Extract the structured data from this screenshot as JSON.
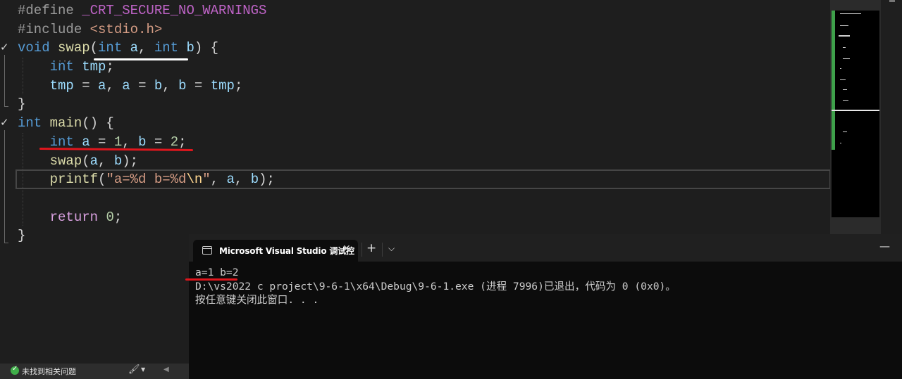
{
  "editor": {
    "lines": [
      [
        {
          "t": "#define ",
          "c": "pp"
        },
        {
          "t": "_CRT_SECURE_NO_WARNINGS",
          "c": "mac"
        }
      ],
      [
        {
          "t": "#include ",
          "c": "pp"
        },
        {
          "t": "<stdio.h>",
          "c": "inc"
        }
      ],
      [
        {
          "t": "void ",
          "c": "kw"
        },
        {
          "t": "swap",
          "c": "fn"
        },
        {
          "t": "(",
          "c": ""
        },
        {
          "t": "int ",
          "c": "kw"
        },
        {
          "t": "a",
          "c": "var"
        },
        {
          "t": ", ",
          "c": ""
        },
        {
          "t": "int ",
          "c": "kw"
        },
        {
          "t": "b",
          "c": "var"
        },
        {
          "t": ") {",
          "c": ""
        }
      ],
      [
        {
          "t": "    ",
          "c": ""
        },
        {
          "t": "int ",
          "c": "kw"
        },
        {
          "t": "tmp",
          "c": "var"
        },
        {
          "t": ";",
          "c": ""
        }
      ],
      [
        {
          "t": "    ",
          "c": ""
        },
        {
          "t": "tmp",
          "c": "var"
        },
        {
          "t": " = ",
          "c": ""
        },
        {
          "t": "a",
          "c": "var"
        },
        {
          "t": ", ",
          "c": ""
        },
        {
          "t": "a",
          "c": "var"
        },
        {
          "t": " = ",
          "c": ""
        },
        {
          "t": "b",
          "c": "var"
        },
        {
          "t": ", ",
          "c": ""
        },
        {
          "t": "b",
          "c": "var"
        },
        {
          "t": " = ",
          "c": ""
        },
        {
          "t": "tmp",
          "c": "var"
        },
        {
          "t": ";",
          "c": ""
        }
      ],
      [
        {
          "t": "}",
          "c": ""
        }
      ],
      [
        {
          "t": "int ",
          "c": "kw"
        },
        {
          "t": "main",
          "c": "fn"
        },
        {
          "t": "() {",
          "c": ""
        }
      ],
      [
        {
          "t": "    ",
          "c": ""
        },
        {
          "t": "int ",
          "c": "kw"
        },
        {
          "t": "a",
          "c": "var"
        },
        {
          "t": " = ",
          "c": ""
        },
        {
          "t": "1",
          "c": "num"
        },
        {
          "t": ", ",
          "c": ""
        },
        {
          "t": "b",
          "c": "var"
        },
        {
          "t": " = ",
          "c": ""
        },
        {
          "t": "2",
          "c": "num"
        },
        {
          "t": ";",
          "c": ""
        }
      ],
      [
        {
          "t": "    ",
          "c": ""
        },
        {
          "t": "swap",
          "c": "fn"
        },
        {
          "t": "(",
          "c": ""
        },
        {
          "t": "a",
          "c": "var"
        },
        {
          "t": ", ",
          "c": ""
        },
        {
          "t": "b",
          "c": "var"
        },
        {
          "t": ");",
          "c": ""
        }
      ],
      [
        {
          "t": "    ",
          "c": ""
        },
        {
          "t": "printf",
          "c": "fn"
        },
        {
          "t": "(",
          "c": ""
        },
        {
          "t": "\"a=%d b=%d",
          "c": "str"
        },
        {
          "t": "\\n",
          "c": "esc"
        },
        {
          "t": "\"",
          "c": "str"
        },
        {
          "t": ", ",
          "c": ""
        },
        {
          "t": "a",
          "c": "var"
        },
        {
          "t": ", ",
          "c": ""
        },
        {
          "t": "b",
          "c": "var"
        },
        {
          "t": ");",
          "c": ""
        }
      ],
      [
        {
          "t": "",
          "c": ""
        }
      ],
      [
        {
          "t": "    ",
          "c": ""
        },
        {
          "t": "return ",
          "c": "ctl"
        },
        {
          "t": "0",
          "c": "num"
        },
        {
          "t": ";",
          "c": ""
        }
      ],
      [
        {
          "t": "}",
          "c": ""
        }
      ]
    ],
    "checkmark": "✓"
  },
  "status_bar": {
    "issues_text": "未找到相关问题"
  },
  "terminal": {
    "tab_title": "Microsoft Visual Studio 调试控",
    "close_glyph": "✕",
    "new_tab_glyph": "+",
    "dropdown_glyph": "⌵",
    "minimize_glyph": "—",
    "output_line1": "a=1 b=2",
    "output_line2": "",
    "output_line3": "D:\\vs2022 c project\\9-6-1\\x64\\Debug\\9-6-1.exe (进程 7996)已退出，代码为 0 (0x0)。",
    "output_line4": "按任意键关闭此窗口. . ."
  }
}
